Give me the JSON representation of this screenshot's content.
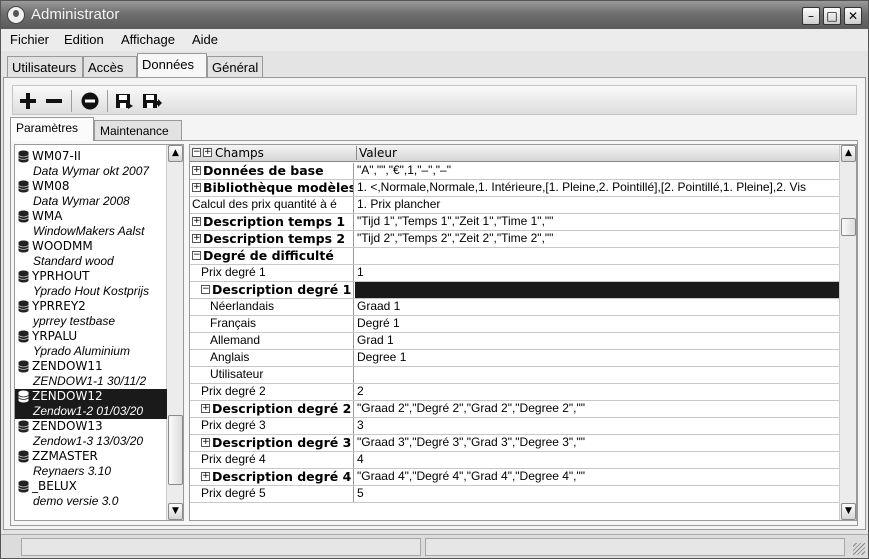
{
  "window": {
    "title": "Administrator"
  },
  "menu": [
    "Fichier",
    "Edition",
    "Affichage",
    "Aide"
  ],
  "tabs": [
    "Utilisateurs",
    "Accès",
    "Données",
    "Général"
  ],
  "subtabs": [
    "Paramètres",
    "Maintenance"
  ],
  "toolbar": {
    "icons": [
      "plus-icon",
      "minus-icon",
      "stop-icon",
      "save-icon",
      "save-as-icon"
    ]
  },
  "databases": [
    {
      "name": "WM07-II",
      "desc": "Data Wymar okt 2007"
    },
    {
      "name": "WM08",
      "desc": "Data Wymar 2008"
    },
    {
      "name": "WMA",
      "desc": "WindowMakers Aalst"
    },
    {
      "name": "WOODMM",
      "desc": "Standard wood"
    },
    {
      "name": "YPRHOUT",
      "desc": "Yprado Hout Kostprijs"
    },
    {
      "name": "YPRREY2",
      "desc": "yprrey testbase"
    },
    {
      "name": "YRPALU",
      "desc": "Yprado Aluminium"
    },
    {
      "name": "ZENDOW11",
      "desc": "ZENDOW1-1 30/11/2"
    },
    {
      "name": "ZENDOW12",
      "desc": "Zendow1-2 01/03/20"
    },
    {
      "name": "ZENDOW13",
      "desc": "Zendow1-3 13/03/20"
    },
    {
      "name": "ZZMASTER",
      "desc": "Reynaers 3.10"
    },
    {
      "name": "_BELUX",
      "desc": "demo versie 3.0"
    }
  ],
  "grid": {
    "col_champs": "Champs",
    "col_valeur": "Valeur",
    "rows": [
      {
        "label": "Données de base",
        "value": "\"A\",\"\",\"€\",1,\"–\",\"–\""
      },
      {
        "label": "Bibliothèque modèles",
        "value": "1. <,Normale,Normale,1. Intérieure,[1. Pleine,2. Pointillé],[2. Pointillé,1. Pleine],2. Vis"
      },
      {
        "label": "Calcul des prix quantité à é",
        "value": "1. Prix plancher"
      },
      {
        "label": "Description temps 1",
        "value": "\"Tijd 1\",\"Temps 1\",\"Zeit 1\",\"Time 1\",\"\""
      },
      {
        "label": "Description temps 2",
        "value": "\"Tijd 2\",\"Temps 2\",\"Zeit 2\",\"Time 2\",\"\""
      },
      {
        "label": "Degré de difficulté",
        "value": ""
      },
      {
        "label": "Prix degré 1",
        "value": "1"
      },
      {
        "label": "Description degré 1",
        "value": ""
      },
      {
        "label": "Néerlandais",
        "value": "Graad 1"
      },
      {
        "label": "Français",
        "value": "Degré 1"
      },
      {
        "label": "Allemand",
        "value": "Grad 1"
      },
      {
        "label": "Anglais",
        "value": "Degree 1"
      },
      {
        "label": "Utilisateur",
        "value": ""
      },
      {
        "label": "Prix degré 2",
        "value": "2"
      },
      {
        "label": "Description degré 2",
        "value": "\"Graad 2\",\"Degré 2\",\"Grad 2\",\"Degree 2\",\"\""
      },
      {
        "label": "Prix degré 3",
        "value": "3"
      },
      {
        "label": "Description degré 3",
        "value": "\"Graad 3\",\"Degré 3\",\"Grad 3\",\"Degree 3\",\"\""
      },
      {
        "label": "Prix degré 4",
        "value": "4"
      },
      {
        "label": "Description degré 4",
        "value": "\"Graad 4\",\"Degré 4\",\"Grad 4\",\"Degree 4\",\"\""
      },
      {
        "label": "Prix degré 5",
        "value": "5"
      }
    ]
  }
}
